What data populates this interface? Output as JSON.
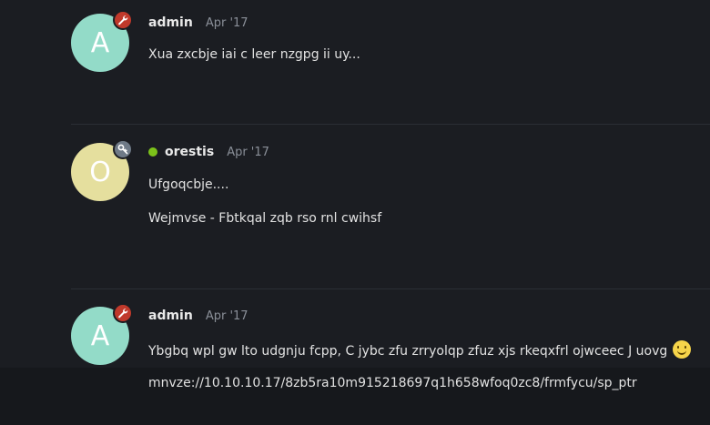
{
  "posts": [
    {
      "avatar_letter": "A",
      "avatar_color": "#93dbc8",
      "badge_icon": "wrench-icon",
      "badge_color": "#c0392b",
      "username": "admin",
      "online": false,
      "date": "Apr '17",
      "paragraphs": [
        "Xua zxcbje iai c leer nzgpg ii uy..."
      ]
    },
    {
      "avatar_letter": "O",
      "avatar_color": "#e5df9e",
      "badge_icon": "key-icon",
      "badge_color": "#6f7a87",
      "username": "orestis",
      "online": true,
      "date": "Apr '17",
      "paragraphs": [
        "Ufgoqcbje....",
        "Wejmvse - Fbtkqal zqb rso rnl cwihsf"
      ]
    },
    {
      "avatar_letter": "A",
      "avatar_color": "#93dbc8",
      "badge_icon": "wrench-icon",
      "badge_color": "#c0392b",
      "username": "admin",
      "online": false,
      "date": "Apr '17",
      "paragraphs": [
        "Ybgbq wpl gw lto udgnju fcpp, C jybc zfu zrryolqp zfuz xjs rkeqxfrl ojwceec J uovg",
        "mnvze://10.10.10.17/8zb5ra10m915218697q1h658wfoq0zc8/frmfycu/sp_ptr"
      ],
      "emoji": "slightly-smiling-face-icon"
    }
  ],
  "colors": {
    "background": "#1b1d22",
    "online": "#7cc21a",
    "muted": "#8a8f98"
  }
}
